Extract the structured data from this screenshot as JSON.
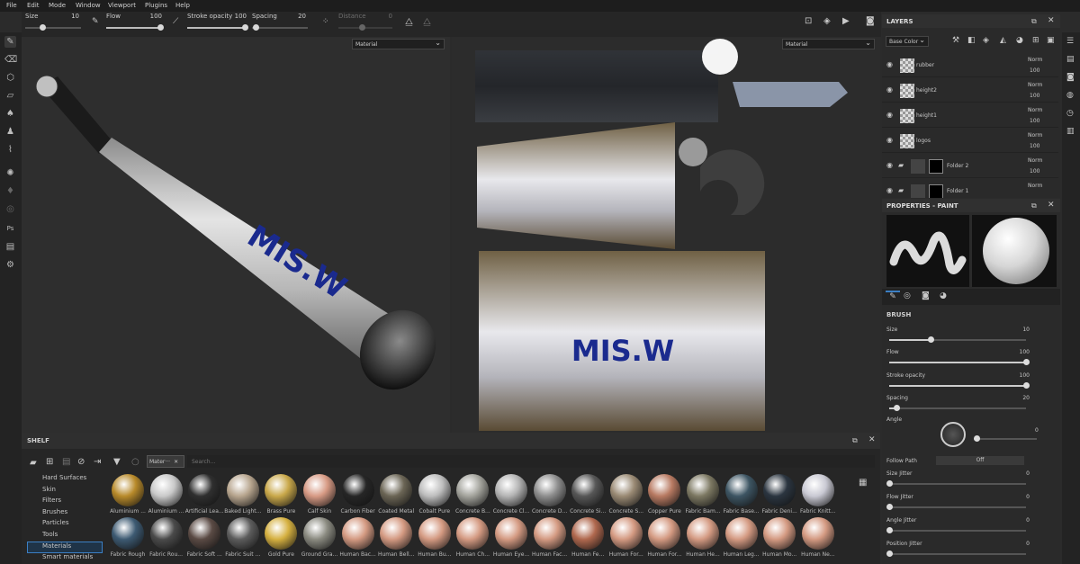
{
  "menu": [
    "File",
    "Edit",
    "Mode",
    "Window",
    "Viewport",
    "Plugins",
    "Help"
  ],
  "toolbar": {
    "size_label": "Size",
    "size_value": "10",
    "flow_label": "Flow",
    "flow_value": "100",
    "stroke_label": "Stroke opacity",
    "stroke_value": "100",
    "spacing_label": "Spacing",
    "spacing_value": "20",
    "distance_label": "Distance",
    "distance_value": "0"
  },
  "viewport": {
    "left_mode": "Material",
    "right_mode": "Material"
  },
  "decal": {
    "logo_text": "MIS.W"
  },
  "layers": {
    "title": "LAYERS",
    "channel": "Base Color",
    "items": [
      {
        "name": "rubber",
        "blend": "Norm",
        "opacity": "100"
      },
      {
        "name": "height2",
        "blend": "Norm",
        "opacity": "100"
      },
      {
        "name": "height1",
        "blend": "Norm",
        "opacity": "100"
      },
      {
        "name": "logos",
        "blend": "Norm",
        "opacity": "100"
      },
      {
        "name": "Folder 2",
        "blend": "Norm",
        "opacity": "100"
      },
      {
        "name": "Folder 1",
        "blend": "Norm",
        "opacity": ""
      }
    ]
  },
  "properties": {
    "title": "PROPERTIES - PAINT",
    "section": "BRUSH",
    "size": {
      "label": "Size",
      "value": "10",
      "fraction": 0.3
    },
    "flow": {
      "label": "Flow",
      "value": "100",
      "fraction": 1.0
    },
    "stroke": {
      "label": "Stroke opacity",
      "value": "100",
      "fraction": 1.0
    },
    "spacing": {
      "label": "Spacing",
      "value": "20",
      "fraction": 0.05
    },
    "angle": {
      "label": "Angle",
      "value": "0"
    },
    "follow_path": {
      "label": "Follow Path",
      "value": "Off"
    },
    "size_jitter": {
      "label": "Size Jitter",
      "value": "0"
    },
    "flow_jitter": {
      "label": "Flow Jitter",
      "value": "0"
    },
    "angle_jitter": {
      "label": "Angle Jitter",
      "value": "0"
    },
    "position_jitter": {
      "label": "Position Jitter",
      "value": "0"
    }
  },
  "shelf": {
    "title": "SHELF",
    "filter_tag": "Mater···",
    "search_placeholder": "Search...",
    "categories": [
      "Hard Surfaces",
      "Skin",
      "Filters",
      "Brushes",
      "Particles",
      "Tools",
      "Materials",
      "Smart materials"
    ],
    "selected_category": "Materials",
    "row1": [
      "Aluminium ...",
      "Aluminium ...",
      "Artificial Lea...",
      "Baked Light...",
      "Brass Pure",
      "Calf Skin",
      "Carbon Fiber",
      "Coated Metal",
      "Cobalt Pure",
      "Concrete B...",
      "Concrete Cl...",
      "Concrete D...",
      "Concrete Si...",
      "Concrete S...",
      "Copper Pure",
      "Fabric Bam...",
      "Fabric Base...",
      "Fabric Deni...",
      "Fabric Knitt..."
    ],
    "row2": [
      "Fabric Rough",
      "Fabric Rou...",
      "Fabric Soft ...",
      "Fabric Suit ...",
      "Gold Pure",
      "Ground Gra...",
      "Human Bac...",
      "Human Bell...",
      "Human Bu...",
      "Human Ch...",
      "Human Eye...",
      "Human Fac...",
      "Human Fe...",
      "Human For...",
      "Human For...",
      "Human He...",
      "Human Leg...",
      "Human Mo...",
      "Human Ne..."
    ],
    "row1_colors": [
      "#b88a2a",
      "#c9c9c9",
      "#2f2f2f",
      "#b7a58e",
      "#c9a84a",
      "#d79a84",
      "#262626",
      "#6b6555",
      "#bdbdbd",
      "#a3a39c",
      "#b4b4b4",
      "#8e8e8e",
      "#575757",
      "#9a8a74",
      "#b87a62",
      "#7c7862",
      "#3d5563",
      "#2b3540",
      "#c9c9d3"
    ],
    "row2_colors": [
      "#3d5a72",
      "#4a4a4a",
      "#5a4a44",
      "#5c5c5c",
      "#d5b040",
      "#8a8a80",
      "#d49a82",
      "#d49a82",
      "#d49a82",
      "#d49a82",
      "#d49a82",
      "#d49a82",
      "#b0684e",
      "#d49a82",
      "#d49a82",
      "#d49a82",
      "#d49a82",
      "#d49a82",
      "#d49a82"
    ]
  }
}
